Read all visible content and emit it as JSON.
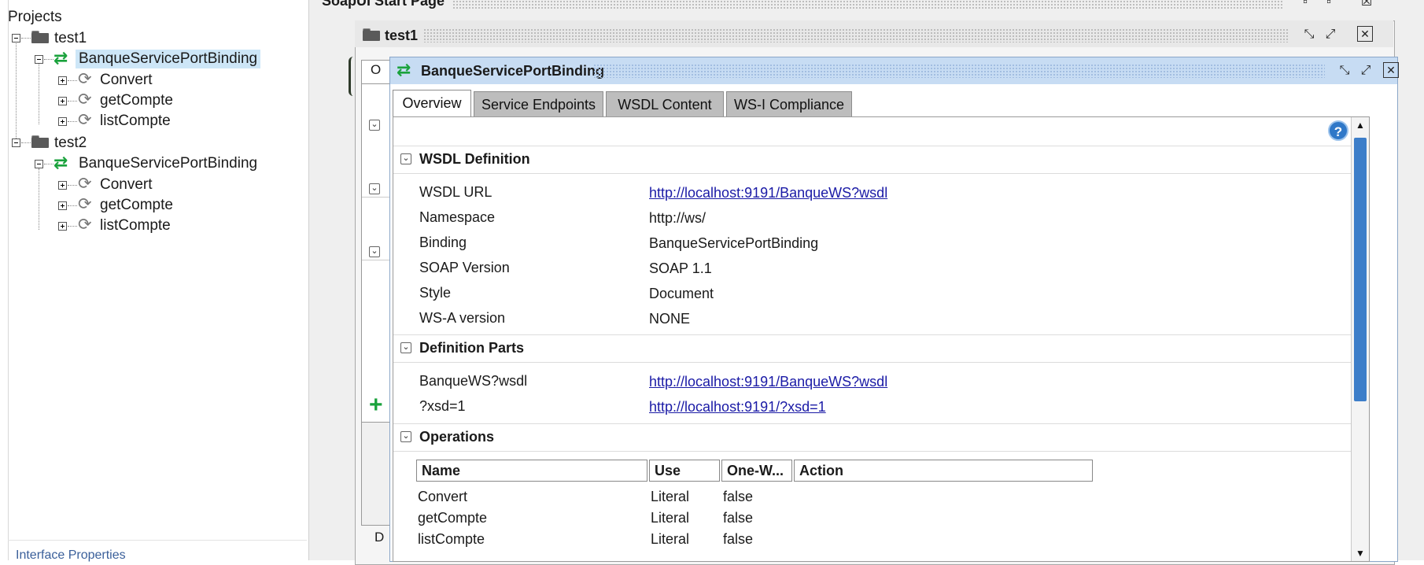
{
  "navigator": {
    "root_label": "Projects",
    "projects": [
      {
        "name": "test1",
        "interface": "BanqueServicePortBinding",
        "operations": [
          "Convert",
          "getCompte",
          "listCompte"
        ]
      },
      {
        "name": "test2",
        "interface": "BanqueServicePortBinding",
        "operations": [
          "Convert",
          "getCompte",
          "listCompte"
        ]
      }
    ],
    "bottom_panel_label": "Interface Properties"
  },
  "start_page": {
    "title": "SoapUI Start Page"
  },
  "project_frame": {
    "title": "test1",
    "partial_tab": "O",
    "partial_bottom": "D"
  },
  "interface_frame": {
    "title": "BanqueServicePortBinding",
    "tabs": [
      {
        "label": "Overview",
        "active": true
      },
      {
        "label": "Service Endpoints",
        "active": false
      },
      {
        "label": "WSDL Content",
        "active": false
      },
      {
        "label": "WS-I Compliance",
        "active": false
      }
    ],
    "help_label": "?",
    "sections": {
      "wsdl_definition": {
        "header": "WSDL Definition",
        "rows": [
          {
            "label": "WSDL URL",
            "value": "http://localhost:9191/BanqueWS?wsdl",
            "link": true
          },
          {
            "label": "Namespace",
            "value": "http://ws/",
            "link": false
          },
          {
            "label": "Binding",
            "value": "BanqueServicePortBinding",
            "link": false
          },
          {
            "label": "SOAP Version",
            "value": "SOAP 1.1",
            "link": false
          },
          {
            "label": "Style",
            "value": "Document",
            "link": false
          },
          {
            "label": "WS-A version",
            "value": "NONE",
            "link": false
          }
        ]
      },
      "definition_parts": {
        "header": "Definition Parts",
        "rows": [
          {
            "label": "BanqueWS?wsdl",
            "value": "http://localhost:9191/BanqueWS?wsdl",
            "link": true
          },
          {
            "label": "?xsd=1",
            "value": "http://localhost:9191/?xsd=1",
            "link": true
          }
        ]
      },
      "operations": {
        "header": "Operations",
        "columns": [
          "Name",
          "Use",
          "One-W...",
          "Action"
        ],
        "rows": [
          [
            "Convert",
            "Literal",
            "false",
            ""
          ],
          [
            "getCompte",
            "Literal",
            "false",
            ""
          ],
          [
            "listCompte",
            "Literal",
            "false",
            ""
          ]
        ]
      }
    }
  },
  "colors": {
    "interface_title_bg": "#c7dcf3",
    "link": "#1a1aa6",
    "swap_icon": "#1aa23c",
    "scroll_thumb": "#3d7ec9"
  },
  "icons": {
    "project": "folder-icon",
    "interface": "swap-arrows-icon",
    "operation": "refresh-icon",
    "minimize": "minimize-icon",
    "maximize": "maximize-icon",
    "close": "close-icon"
  }
}
